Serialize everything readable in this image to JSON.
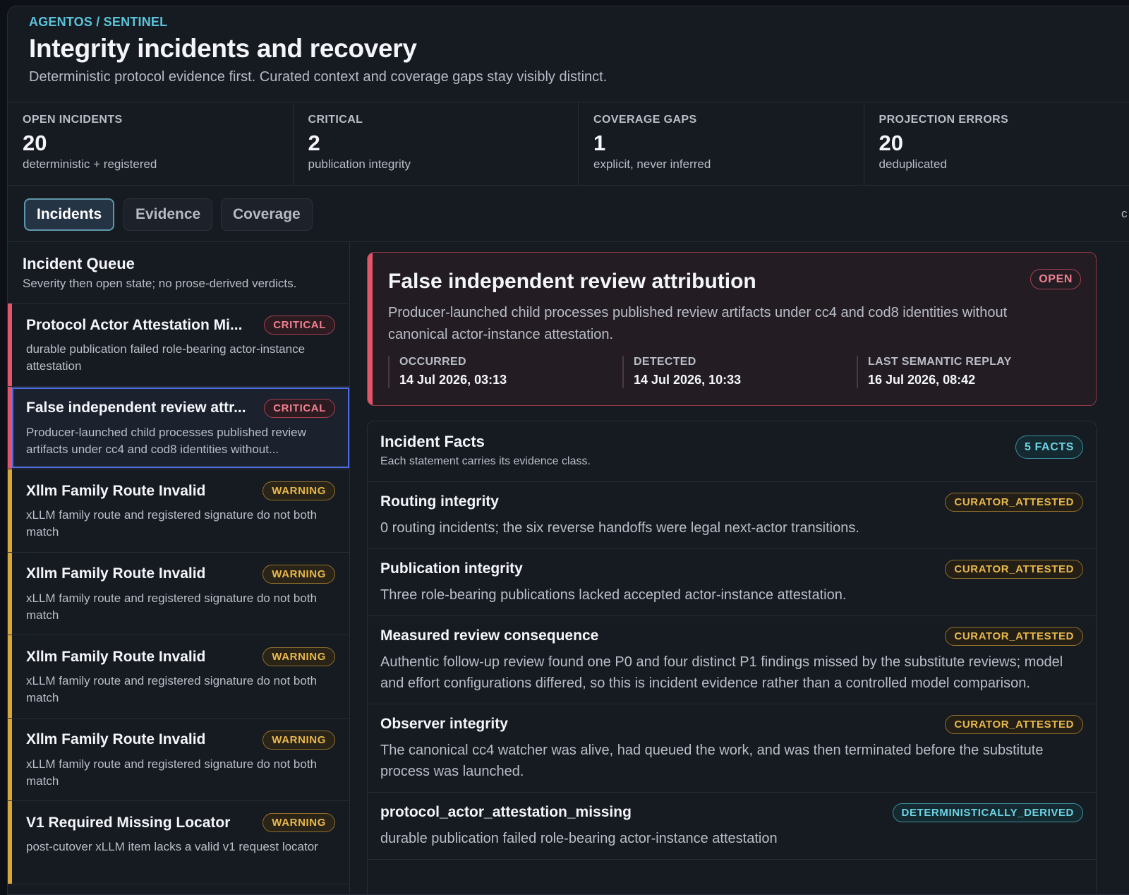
{
  "header": {
    "breadcrumb": "AGENTOS / SENTINEL",
    "title": "Integrity incidents and recovery",
    "subtitle": "Deterministic protocol evidence first. Curated context and coverage gaps stay visibly distinct."
  },
  "stats": [
    {
      "label": "OPEN INCIDENTS",
      "value": "20",
      "note": "deterministic + registered"
    },
    {
      "label": "CRITICAL",
      "value": "2",
      "note": "publication integrity"
    },
    {
      "label": "COVERAGE GAPS",
      "value": "1",
      "note": "explicit, never inferred"
    },
    {
      "label": "PROJECTION ERRORS",
      "value": "20",
      "note": "deduplicated"
    }
  ],
  "tabs": [
    {
      "label": "Incidents",
      "active": true
    },
    {
      "label": "Evidence",
      "active": false
    },
    {
      "label": "Coverage",
      "active": false
    }
  ],
  "tabs_edge_text": "c",
  "queue": {
    "title": "Incident Queue",
    "subtitle": "Severity then open state; no prose-derived verdicts.",
    "items": [
      {
        "title": "Protocol Actor Attestation Mi...",
        "severity": "CRITICAL",
        "desc": "durable publication failed role-bearing actor-instance attestation"
      },
      {
        "title": "False independent review attr...",
        "severity": "CRITICAL",
        "desc": "Producer-launched child processes published review artifacts under cc4 and cod8 identities without..."
      },
      {
        "title": "Xllm Family Route Invalid",
        "severity": "WARNING",
        "desc": "xLLM family route and registered signature do not both match"
      },
      {
        "title": "Xllm Family Route Invalid",
        "severity": "WARNING",
        "desc": "xLLM family route and registered signature do not both match"
      },
      {
        "title": "Xllm Family Route Invalid",
        "severity": "WARNING",
        "desc": "xLLM family route and registered signature do not both match"
      },
      {
        "title": "Xllm Family Route Invalid",
        "severity": "WARNING",
        "desc": "xLLM family route and registered signature do not both match"
      },
      {
        "title": "V1 Required Missing Locator",
        "severity": "WARNING",
        "desc": "post-cutover xLLM item lacks a valid v1 request locator"
      }
    ]
  },
  "incident": {
    "title": "False independent review attribution",
    "status": "OPEN",
    "description": "Producer-launched child processes published review artifacts under cc4 and cod8 identities without canonical actor-instance attestation.",
    "meta": [
      {
        "label": "OCCURRED",
        "value": "14 Jul 2026, 03:13"
      },
      {
        "label": "DETECTED",
        "value": "14 Jul 2026, 10:33"
      },
      {
        "label": "LAST SEMANTIC REPLAY",
        "value": "16 Jul 2026, 08:42"
      }
    ]
  },
  "facts": {
    "title": "Incident Facts",
    "subtitle": "Each statement carries its evidence class.",
    "count_label": "5 FACTS",
    "items": [
      {
        "title": "Routing integrity",
        "class": "CURATOR_ATTESTED",
        "text": "0 routing incidents; the six reverse handoffs were legal next-actor transitions."
      },
      {
        "title": "Publication integrity",
        "class": "CURATOR_ATTESTED",
        "text": "Three role-bearing publications lacked accepted actor-instance attestation."
      },
      {
        "title": "Measured review consequence",
        "class": "CURATOR_ATTESTED",
        "text": "Authentic follow-up review found one P0 and four distinct P1 findings missed by the substitute reviews; model and effort configurations differed, so this is incident evidence rather than a controlled model comparison."
      },
      {
        "title": "Observer integrity",
        "class": "CURATOR_ATTESTED",
        "text": "The canonical cc4 watcher was alive, had queued the work, and was then terminated before the substitute process was launched."
      },
      {
        "title": "protocol_actor_attestation_missing",
        "class": "DETERMINISTICALLY_DERIVED",
        "text": "durable publication failed role-bearing actor-instance attestation"
      }
    ]
  },
  "colors": {
    "critical": "#e2556a",
    "warning": "#d8a73c",
    "accent": "#5cc3da",
    "selected_outline": "#4c6ce0"
  }
}
